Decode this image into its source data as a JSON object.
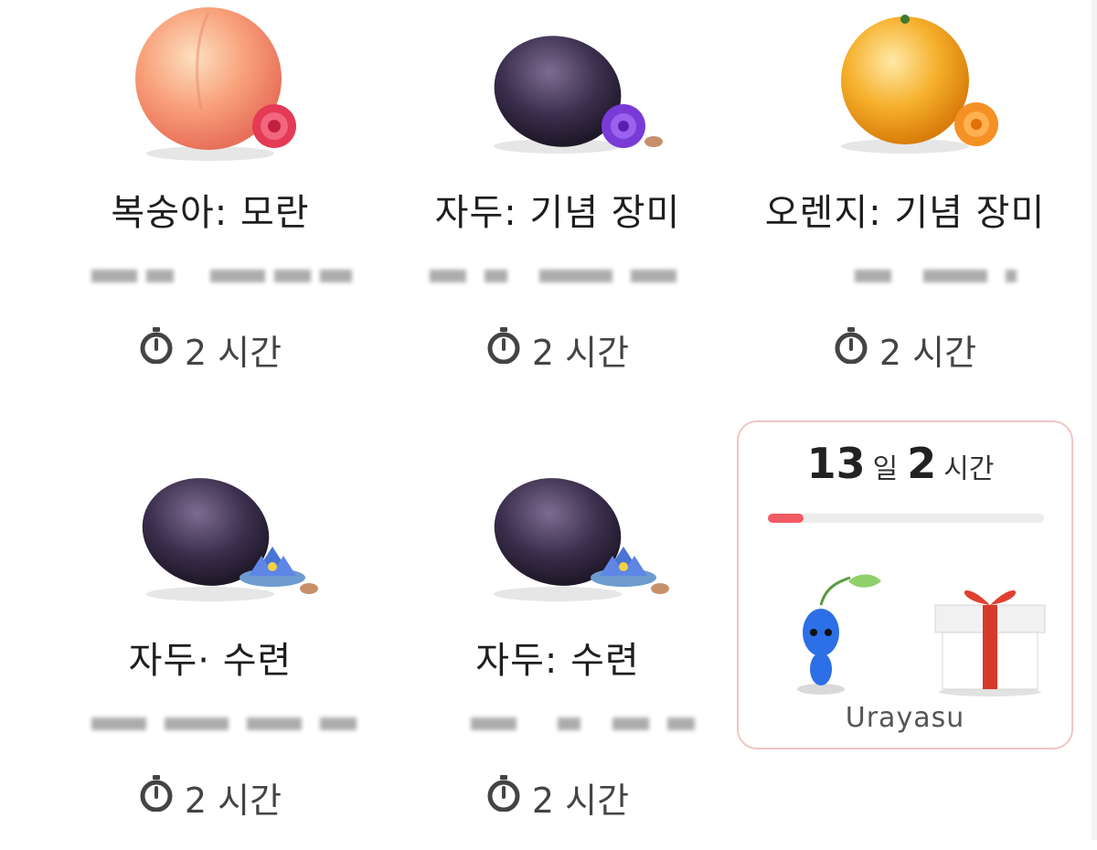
{
  "cards": [
    {
      "title": "복숭아: 모란",
      "timer": "2 시간",
      "fruit": "peach",
      "flower": "peony"
    },
    {
      "title": "자두: 기념 장미",
      "timer": "2 시간",
      "fruit": "plum",
      "flower": "purple-rose"
    },
    {
      "title": "오렌지: 기념 장미",
      "timer": "2 시간",
      "fruit": "orange",
      "flower": "orange-rose"
    },
    {
      "title": "자두· 수련",
      "timer": "2 시간",
      "fruit": "plum",
      "flower": "water-lily"
    },
    {
      "title": "자두: 수련",
      "timer": "2 시간",
      "fruit": "plum",
      "flower": "water-lily"
    }
  ],
  "reward": {
    "days": "13",
    "days_unit": "일",
    "hours": "2",
    "hours_unit": "시간",
    "progress_fraction": 0.13,
    "label": "Urayasu"
  },
  "icons": [
    "stopwatch-icon",
    "pikmin-icon",
    "gift-box-icon"
  ],
  "colors": {
    "accent": "#f25a64",
    "border": "#f2c4c4"
  }
}
